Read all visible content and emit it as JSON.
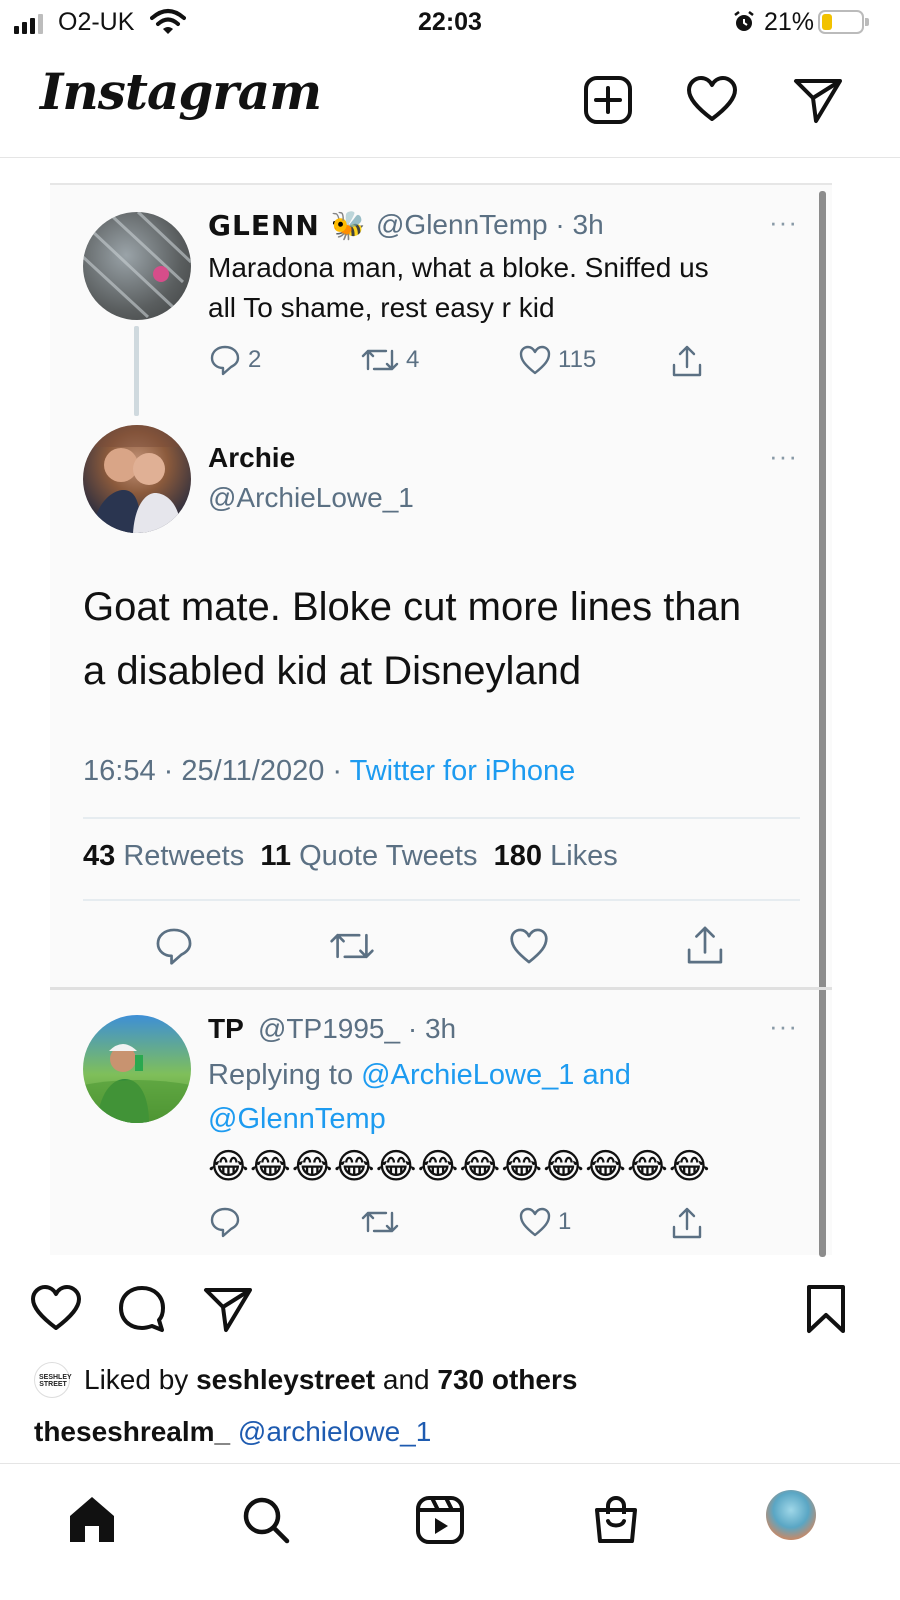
{
  "status_bar": {
    "carrier": "O2-UK",
    "time": "22:03",
    "battery": "21%",
    "battery_level": 0.21
  },
  "header": {
    "logo": "Instagram",
    "icons": [
      "new-post-icon",
      "heart-icon",
      "direct-message-icon"
    ]
  },
  "post": {
    "tweets": [
      {
        "name": "GLENN",
        "emoji": "🐝",
        "handle": "@GlennTemp · 3h",
        "text_line1": "Maradona man, what a bloke. Sniffed us",
        "text_line2": "all To shame, rest easy r kid",
        "replies": "2",
        "retweets": "4",
        "likes": "115"
      },
      {
        "name": "Archie",
        "handle": "@ArchieLowe_1",
        "text_line1": "Goat mate. Bloke cut more lines than",
        "text_line2": "a disabled kid at Disneyland",
        "timestamp": "16:54 · 25/11/2020 · ",
        "source": "Twitter for iPhone",
        "retweets_count": "43",
        "retweets_label": "Retweets",
        "quotes_count": "11",
        "quotes_label": "Quote Tweets",
        "likes_count": "180",
        "likes_label": "Likes"
      },
      {
        "name": "TP",
        "handle": "@TP1995_ · 3h",
        "replying_prefix": "Replying to ",
        "replying_user1": "@ArchieLowe_1",
        "replying_and": " and",
        "replying_user2": "@GlennTemp",
        "emojis": "😂😂😂😂😂😂😂😂😂😂😂😂",
        "likes": "1"
      }
    ],
    "more_label": "···",
    "liked_by_avatar_text": "SESHLEY STREET",
    "liked_by_prefix": "Liked by ",
    "liked_by_user": "seshleystreet",
    "liked_by_and": " and ",
    "liked_by_others": "730 others",
    "caption_user": "theseshrealm_",
    "caption_mention": "@archielowe_1"
  },
  "bottom_nav": {
    "items": [
      "home-icon",
      "search-icon",
      "reels-icon",
      "shop-icon",
      "profile-avatar"
    ]
  }
}
